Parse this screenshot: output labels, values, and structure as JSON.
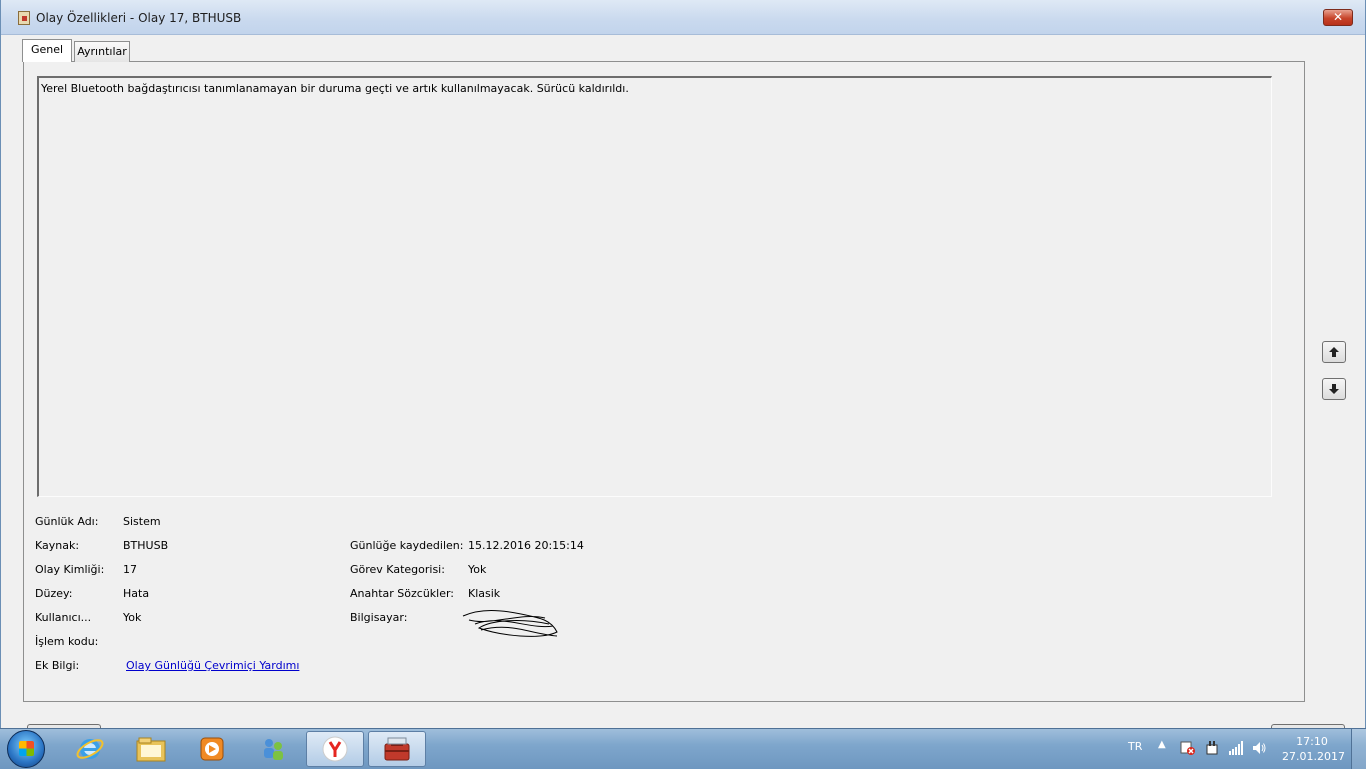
{
  "window": {
    "title": "Olay Özellikleri - Olay 17, BTHUSB",
    "close_label": "✕"
  },
  "tabs": [
    {
      "label": "Genel",
      "selected": true
    },
    {
      "label": "Ayrıntılar",
      "selected": false
    }
  ],
  "message": "Yerel Bluetooth bağdaştırıcısı tanımlanamayan bir duruma geçti ve artık kullanılmayacak. Sürücü kaldırıldı.",
  "fields": {
    "log_name": {
      "label": "Günlük Adı:",
      "value": "Sistem"
    },
    "source": {
      "label": "Kaynak:",
      "value": "BTHUSB"
    },
    "event_id": {
      "label": "Olay Kimliği:",
      "value": "17"
    },
    "level": {
      "label": "Düzey:",
      "value": "Hata"
    },
    "user": {
      "label": "Kullanıcı...",
      "value": "Yok"
    },
    "opcode": {
      "label": "İşlem kodu:",
      "value": ""
    },
    "more_info": {
      "label": "Ek Bilgi:",
      "value": "Olay Günlüğü Çevrimiçi Yardımı"
    },
    "logged": {
      "label": "Günlüğe kaydedilen:",
      "value": "15.12.2016 20:15:14"
    },
    "task_category": {
      "label": "Görev Kategorisi:",
      "value": "Yok"
    },
    "keywords": {
      "label": "Anahtar Sözcükler:",
      "value": "Klasik"
    },
    "computer": {
      "label": "Bilgisayar:",
      "value": ""
    }
  },
  "taskbar": {
    "items": [
      "start-orb",
      "internet-explorer-icon",
      "file-explorer-icon",
      "media-player-icon",
      "network-people-icon",
      "yandex-browser-icon",
      "event-viewer-toolbox-icon"
    ],
    "language": "TR",
    "tray_up_arrow": "▲",
    "time": "17:10",
    "date": "27.01.2017"
  },
  "colors": {
    "titlebar": "#c9d9ee",
    "taskbar": "#7ea6cc",
    "close_button": "#c7442a",
    "link": "#0000cc"
  }
}
